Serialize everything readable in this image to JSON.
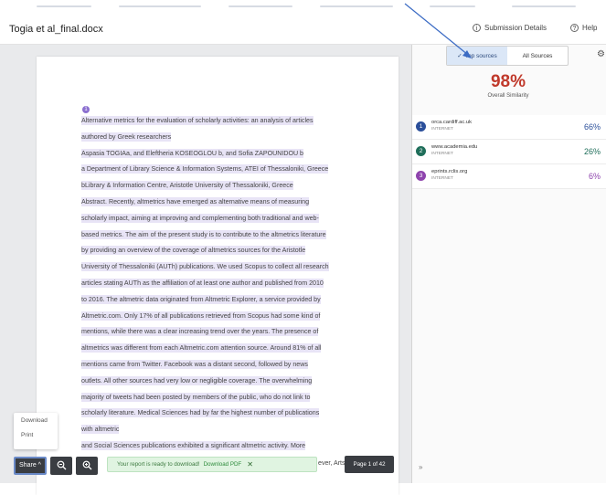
{
  "header": {
    "doc_title": "Togia et al_final.docx",
    "submission_details": "Submission Details",
    "help": "Help"
  },
  "document": {
    "lines": [
      "Alternative metrics for the evaluation of scholarly activities: an analysis of articles",
      "authored by Greek researchers",
      "Aspasia TOGIAa, and Eleftheria KOSEOGLOU b, and Sofia ZAPOUNIDOU b",
      "a Department of Library Science & Information Systems, ATEI of Thessaloniki, Greece",
      "bLibrary & Information Centre, Aristotle University of Thessaloniki, Greece",
      "Abstract. Recently, altmetrics have emerged as alternative means of measuring",
      "scholarly impact, aiming at improving and complementing both traditional and web-",
      "based metrics. The aim of the present study is to contribute to the altmetrics literature",
      "by providing an overview of the coverage of altmetrics sources for the Aristotle",
      "University of Thessaloniki (AUTh) publications. We used Scopus to collect all research",
      "articles stating AUTh as the affiliation of at least one author and published from 2010",
      "to 2016. The altmetric data originated from Altmetric Explorer, a service provided by",
      "Altmetric.com. Only 17% of all publications retrieved from Scopus had some kind of",
      "mentions, while there was a clear increasing trend over the years. The presence of",
      "altmetrics was different from each Altmetric.com attention source. Around 81% of all",
      "mentions came from Twitter. Facebook was a distant second, followed by news",
      "outlets. All other sources had very low or negligible coverage. The overwhelming",
      "majority of tweets had been posted by members of the public, who do not link to",
      "scholarly literature. Medical Sciences had by far the highest number of publications",
      "with altmetric",
      "and Social Sciences publications exhibited a significant altmetric activity. More"
    ],
    "partial_line_tail": "ever, Arts",
    "marker_label": "1"
  },
  "download_menu": {
    "download": "Download",
    "print": "Print"
  },
  "toolbar": {
    "share": "Share ^",
    "zoom_out_icon": "zoom-out-icon",
    "zoom_in_icon": "zoom-in-icon",
    "toast_text": "Your report is ready to download!",
    "toast_link": "Download PDF",
    "toast_close": "✕",
    "page_indicator": "Page 1 of 42"
  },
  "panel": {
    "tab_top": "Top sources",
    "tab_all": "All Sources",
    "score": "98%",
    "score_label": "Overall Similarity",
    "sources": [
      {
        "num": "1",
        "name": "orca.cardiff.ac.uk",
        "sub": "INTERNET",
        "pct": "66%",
        "color": "#2b4f9a",
        "pct_color": "#2b4f9a"
      },
      {
        "num": "2",
        "name": "www.academia.edu",
        "sub": "INTERNET",
        "pct": "26%",
        "color": "#1f6e5a",
        "pct_color": "#1f6e5a"
      },
      {
        "num": "3",
        "name": "eprints.rclis.org",
        "sub": "INTERNET",
        "pct": "6%",
        "color": "#8e44ad",
        "pct_color": "#8e44ad"
      }
    ],
    "collapse": "»"
  },
  "colors": {
    "score": "#c0392b",
    "highlight": "#e8e4f6",
    "toast_bg": "#e0f4e1",
    "arrow": "#3b6bc4"
  }
}
